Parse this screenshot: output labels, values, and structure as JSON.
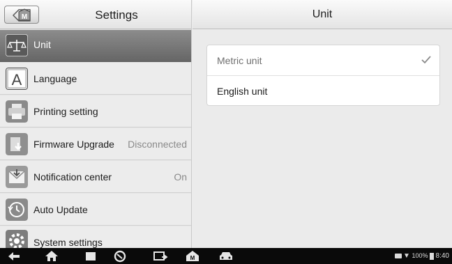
{
  "left_header": {
    "title": "Settings",
    "home_icon_letter": "M"
  },
  "menu": [
    {
      "label": "Unit",
      "value": "",
      "icon": "scale-icon",
      "active": true
    },
    {
      "label": "Language",
      "value": "",
      "icon": "letter-a-icon",
      "active": false
    },
    {
      "label": "Printing setting",
      "value": "",
      "icon": "printer-icon",
      "active": false
    },
    {
      "label": "Firmware Upgrade",
      "value": "Disconnected",
      "icon": "firmware-download-icon",
      "active": false
    },
    {
      "label": "Notification center",
      "value": "On",
      "icon": "notification-icon",
      "active": false
    },
    {
      "label": "Auto Update",
      "value": "",
      "icon": "clock-update-icon",
      "active": false
    },
    {
      "label": "System settings",
      "value": "",
      "icon": "gear-icon",
      "active": false
    }
  ],
  "right_header": {
    "title": "Unit"
  },
  "options": [
    {
      "label": "Metric unit",
      "selected": true
    },
    {
      "label": "English unit",
      "selected": false
    }
  ],
  "navbar": {
    "icons": [
      "back-icon",
      "home-icon",
      "recent-apps-icon",
      "browser-icon",
      "screenshot-icon",
      "maxisys-home-icon",
      "car-icon"
    ],
    "status": {
      "battery": "100%",
      "time": "8:40"
    }
  },
  "colors": {
    "active_item": "#7a7a7a",
    "header_bg": "#f2f2f2",
    "navbar_bg": "#0a0a0a"
  }
}
